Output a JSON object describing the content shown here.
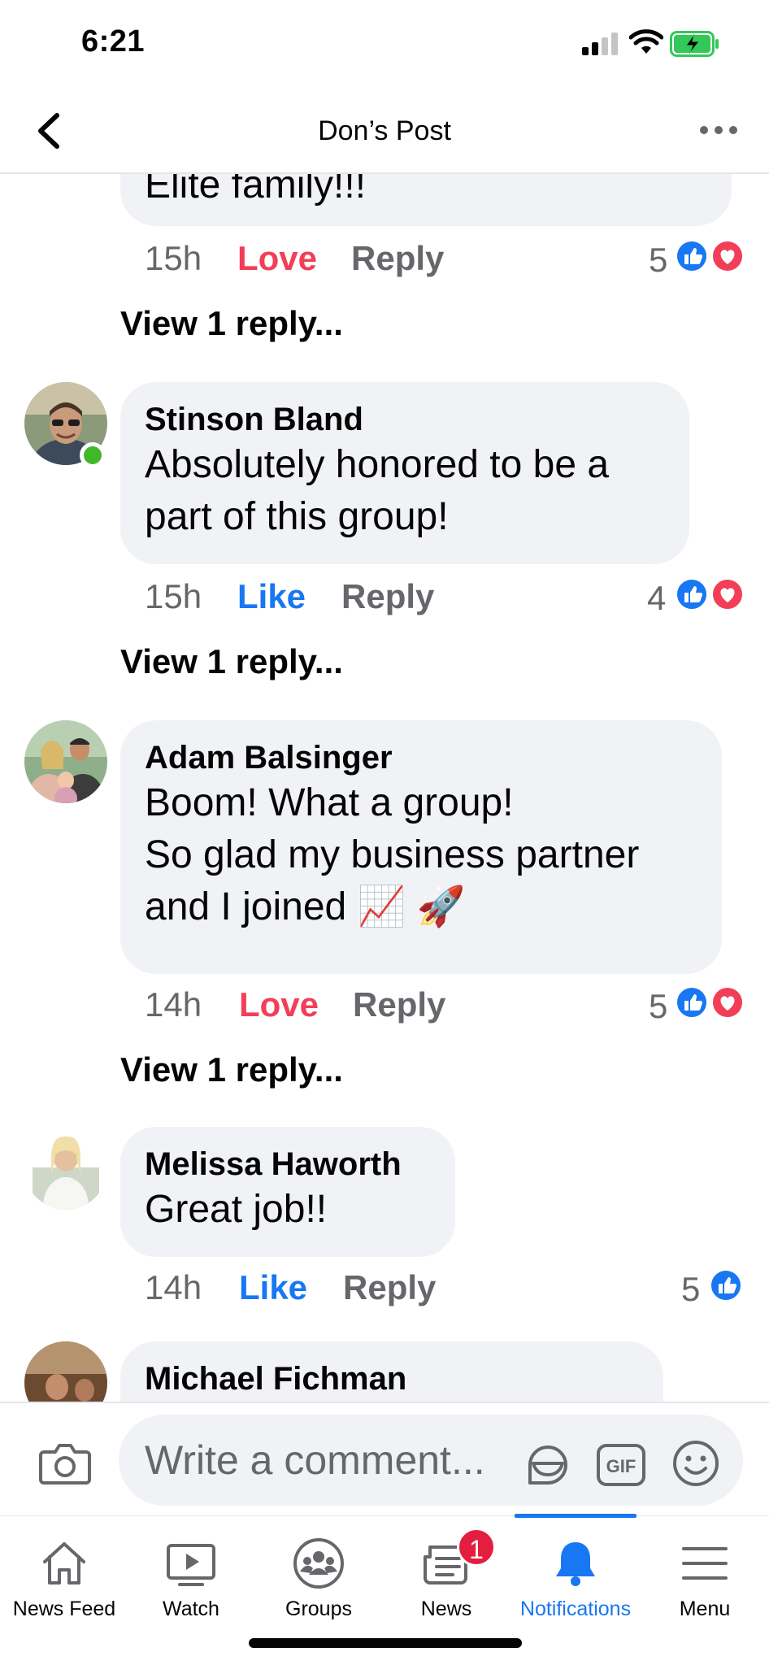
{
  "status_bar": {
    "time": "6:21"
  },
  "header": {
    "title": "Don’s Post"
  },
  "comments": [
    {
      "text": "Elite family!!!",
      "time": "15h",
      "reaction_action": "Love",
      "reply_label": "Reply",
      "reaction_count": "5",
      "reactions": [
        "like-icon",
        "heart-icon"
      ],
      "view_replies": "View 1 reply..."
    },
    {
      "name": "Stinson Bland",
      "text": "Absolutely honored to be a\npart of this group!",
      "time": "15h",
      "reaction_action": "Like",
      "reply_label": "Reply",
      "reaction_count": "4",
      "reactions": [
        "like-icon",
        "heart-icon"
      ],
      "view_replies": "View 1 reply..."
    },
    {
      "name": "Adam Balsinger",
      "text": "Boom! What a group!\nSo glad my business partner\nand I joined 📈 🚀",
      "time": "14h",
      "reaction_action": "Love",
      "reply_label": "Reply",
      "reaction_count": "5",
      "reactions": [
        "like-icon",
        "heart-icon"
      ],
      "view_replies": "View 1 reply..."
    },
    {
      "name": "Melissa Haworth",
      "text": "Great job!!",
      "time": "14h",
      "reaction_action": "Like",
      "reply_label": "Reply",
      "reaction_count": "5",
      "reactions": [
        "like-icon"
      ]
    },
    {
      "name": "Michael Fichman"
    }
  ],
  "composer": {
    "placeholder": "Write a comment..."
  },
  "tabs": [
    {
      "label": "News Feed",
      "icon": "home-icon"
    },
    {
      "label": "Watch",
      "icon": "watch-icon"
    },
    {
      "label": "Groups",
      "icon": "groups-icon"
    },
    {
      "label": "News",
      "icon": "news-icon",
      "badge": "1"
    },
    {
      "label": "Notifications",
      "icon": "bell-icon",
      "active": true
    },
    {
      "label": "Menu",
      "icon": "menu-icon"
    }
  ],
  "colors": {
    "accent": "#1877f2",
    "love": "#f33e58",
    "bubble": "#f0f2f5",
    "secondary_text": "#65676b",
    "online": "#42b72a"
  }
}
